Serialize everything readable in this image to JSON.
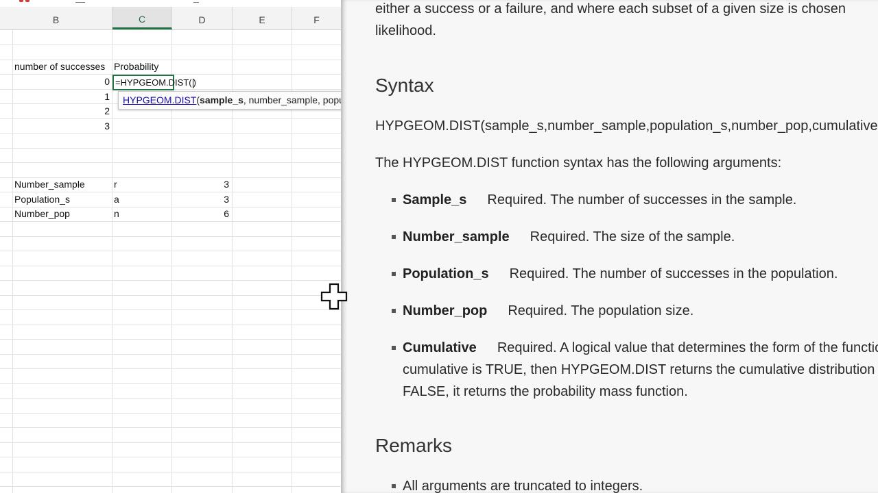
{
  "sheet": {
    "columns": [
      {
        "label": "B",
        "active": false
      },
      {
        "label": "C",
        "active": true
      },
      {
        "label": "D",
        "active": false
      },
      {
        "label": "E",
        "active": false
      },
      {
        "label": "F",
        "active": false
      }
    ],
    "header_row": {
      "b": "number of successes",
      "c": "Probability"
    },
    "success_values": [
      "0",
      "1",
      "2",
      "3"
    ],
    "params": [
      {
        "name": "Number_sample",
        "symbol": "r",
        "value": "3"
      },
      {
        "name": "Population_s",
        "symbol": "a",
        "value": "3"
      },
      {
        "name": "Number_pop",
        "symbol": "n",
        "value": "6"
      }
    ],
    "active_cell_formula": "=HYPGEOM.DIST(",
    "active_cell_close": ")",
    "tooltip": {
      "function_name": "HYPGEOM.DIST",
      "open_paren": "(",
      "active_arg": "sample_s",
      "rest_args": ", number_sample, population_s, number_pop, cumulative)"
    }
  },
  "docs": {
    "intro_line1": "either a success or a failure, and where each subset of a given size is chosen",
    "intro_line2": "likelihood.",
    "syntax_heading": "Syntax",
    "syntax_line": "HYPGEOM.DIST(sample_s,number_sample,population_s,number_pop,cumulative)",
    "args_intro": "The HYPGEOM.DIST function syntax has the following arguments:",
    "arguments": [
      {
        "name": "Sample_s",
        "desc": "Required. The number of successes in the sample."
      },
      {
        "name": "Number_sample",
        "desc": "Required. The size of the sample."
      },
      {
        "name": "Population_s",
        "desc": "Required. The number of successes in the population."
      },
      {
        "name": "Number_pop",
        "desc": "Required. The population size."
      },
      {
        "name": "Cumulative",
        "desc": "Required. A logical value that determines the form of the function. If"
      }
    ],
    "cumulative_line2": "cumulative is TRUE, then HYPGEOM.DIST returns the cumulative distribution function; if",
    "cumulative_line3": "FALSE, it returns the probability mass function.",
    "remarks_heading": "Remarks",
    "remark1": "All arguments are truncated to integers."
  },
  "colors": {
    "excel_green": "#217346",
    "link_blue": "#1a0dab"
  },
  "icons": {
    "cursor": "move-cursor-icon"
  }
}
